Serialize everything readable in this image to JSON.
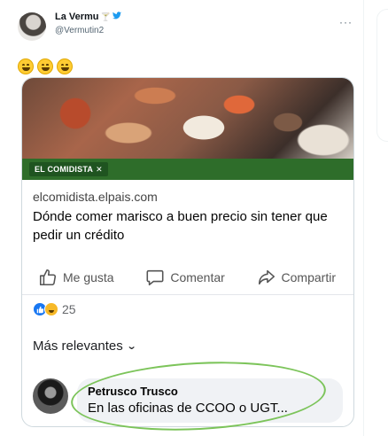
{
  "tweet": {
    "display_name": "La Vermu",
    "name_badge": "🍸",
    "handle": "@Vermutin2",
    "more": "···",
    "emojis": [
      "grinning-face",
      "grinning-face",
      "grinning-face"
    ]
  },
  "fb_post": {
    "brand_logo_text": "EL COMIDISTA",
    "domain": "elcomidista.elpais.com",
    "headline": "Dónde comer marisco a buen precio sin tener que pedir un crédito",
    "actions": [
      {
        "label": "Me gusta",
        "icon": "thumbs-up-icon"
      },
      {
        "label": "Comentar",
        "icon": "comment-icon"
      },
      {
        "label": "Compartir",
        "icon": "share-icon"
      }
    ],
    "reactions": {
      "count": "25",
      "types": [
        "like-icon",
        "haha-icon"
      ]
    },
    "sort_label": "Más relevantes",
    "comment": {
      "author": "Petrusco Trusco",
      "text": "En las oficinas de CCOO o UGT..."
    }
  },
  "colors": {
    "brand_green": "#2e6d2a",
    "highlight_ring": "#7cc45a",
    "like_blue": "#1877f2"
  }
}
